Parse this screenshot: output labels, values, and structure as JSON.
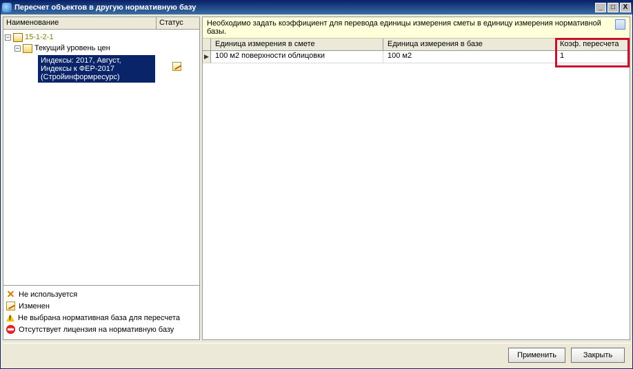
{
  "window": {
    "title": "Пересчет объектов в другую нормативную базу"
  },
  "sysbuttons": {
    "min": "_",
    "max": "□",
    "close": "X"
  },
  "left": {
    "columns": {
      "name": "Наименование",
      "status": "Статус"
    },
    "root": "15-1-2-1",
    "level": "Текущий уровень цен",
    "selected": "Индексы: 2017, Август, Индексы к ФЕР-2017 (Стройинформресурс)"
  },
  "legend": {
    "unused": "Не используется",
    "changed": "Изменен",
    "nobase": "Не выбрана нормативная база для пересчета",
    "nolicense": "Отсутствует лицензия на нормативную базу"
  },
  "info": "Необходимо задать коэффициент для перевода единицы измерения сметы в единицу измерения нормативной базы.",
  "grid": {
    "headers": {
      "unit_smeta": "Единица измерения в смете",
      "unit_base": "Единица измерения в базе",
      "coef": "Коэф. пересчета"
    },
    "rows": [
      {
        "unit_smeta": "100 м2 поверхности облицовки",
        "unit_base": "100 м2",
        "coef": "1"
      }
    ]
  },
  "buttons": {
    "apply": "Применить",
    "close": "Закрыть"
  }
}
